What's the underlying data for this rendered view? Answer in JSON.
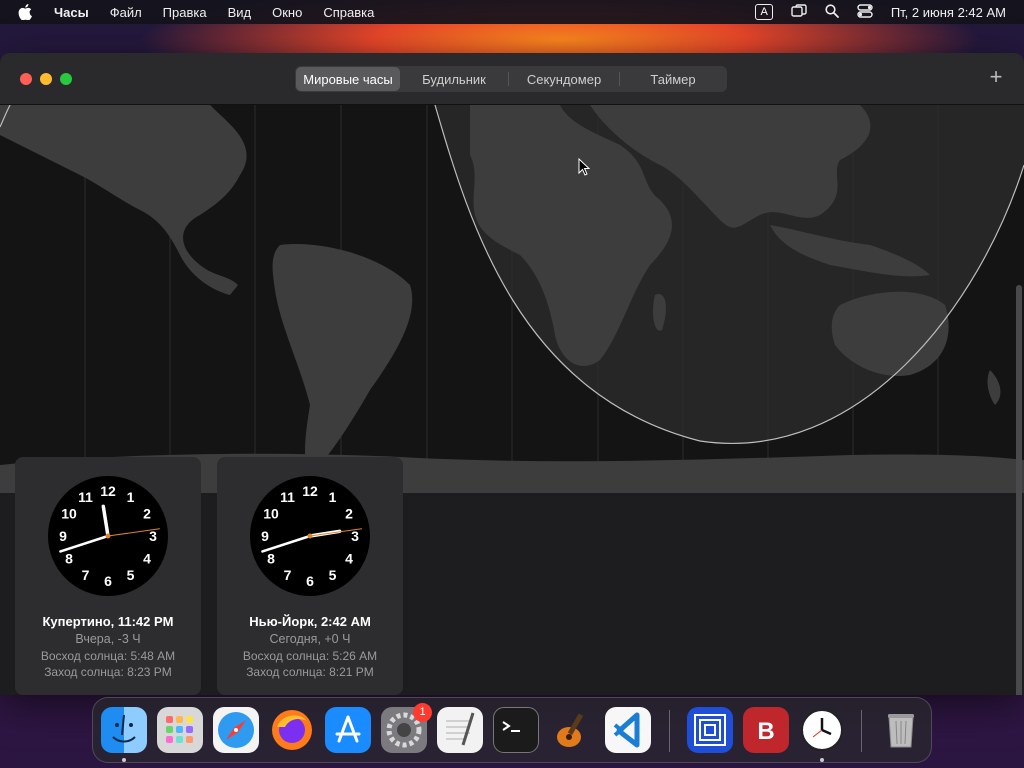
{
  "menubar": {
    "app_name": "Часы",
    "items": [
      "Файл",
      "Правка",
      "Вид",
      "Окно",
      "Справка"
    ],
    "input_badge": "A",
    "datetime": "Пт, 2 июня  2:42 AM"
  },
  "toolbar": {
    "tabs": [
      {
        "label": "Мировые часы",
        "active": true
      },
      {
        "label": "Будильник",
        "active": false
      },
      {
        "label": "Секундомер",
        "active": false
      },
      {
        "label": "Таймер",
        "active": false
      }
    ],
    "add_label": "+"
  },
  "clocks": [
    {
      "city": "Купертино, 11:42 PM",
      "day_offset": "Вчера, -3 Ч",
      "sunrise": "Восход солнца: 5:48 AM",
      "sunset": "Заход солнца: 8:23 PM",
      "time": "11:42"
    },
    {
      "city": "Нью-Йорк, 2:42 AM",
      "day_offset": "Сегодня, +0 Ч",
      "sunrise": "Восход солнца: 5:26 AM",
      "sunset": "Заход солнца: 8:21 PM",
      "time": "2:42"
    }
  ],
  "dial_numbers": [
    "12",
    "1",
    "2",
    "3",
    "4",
    "5",
    "6",
    "7",
    "8",
    "9",
    "10",
    "11"
  ],
  "dock": {
    "apps": [
      "finder-icon",
      "launchpad-icon",
      "safari-icon",
      "firefox-icon",
      "app-store-icon",
      "system-settings-icon",
      "textedit-icon",
      "terminal-icon",
      "garageband-icon",
      "vscode-icon",
      "remote-desktop-icon",
      "bitwarden-icon",
      "clock-app-icon",
      "trash-icon"
    ],
    "settings_badge": "1"
  },
  "colors": {
    "accent_close": "#ff5f57",
    "accent_min": "#febc2e",
    "accent_max": "#28c840",
    "badge": "#ff3b30"
  }
}
